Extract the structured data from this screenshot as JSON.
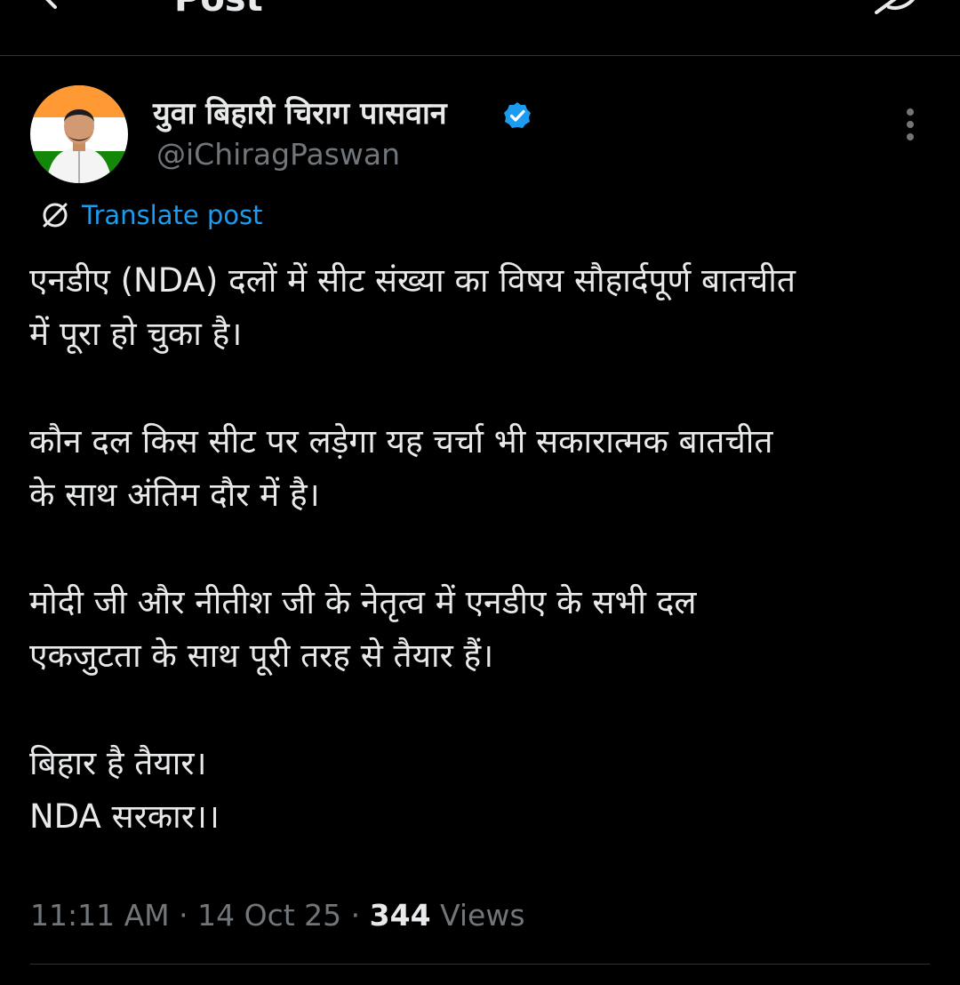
{
  "header": {
    "title": "Post"
  },
  "post": {
    "author": {
      "display_name": "युवा बिहारी चिराग पासवान",
      "handle": "@iChiragPaswan",
      "verified": true
    },
    "translate_label": "Translate post",
    "paragraphs": [
      [
        "एनडीए (NDA) दलों में सीट संख्या का विषय सौहार्दपूर्ण बातचीत",
        "में पूरा हो चुका है।"
      ],
      [
        "कौन दल किस सीट पर लड़ेगा यह चर्चा भी सकारात्मक बातचीत",
        "के साथ अंतिम दौर में है।"
      ],
      [
        "मोदी जी और नीतीश जी के नेतृत्व में एनडीए के सभी दल",
        "एकजुटता के साथ पूरी तरह से तैयार हैं।"
      ],
      [
        "बिहार है तैयार।",
        "NDA सरकार।।"
      ]
    ],
    "time": "11:11 AM",
    "separator": " · ",
    "date": "14 Oct 25",
    "views_count": "344",
    "views_label": " Views"
  },
  "colors": {
    "background": "#000000",
    "text": "#e7e9ea",
    "muted": "#71767b",
    "link": "#1d9bf0",
    "divider": "#2f3336"
  },
  "icons": {
    "back": "back-arrow-icon",
    "grok": "grok-icon",
    "verified": "verified-badge-icon",
    "more": "more-vertical-icon",
    "translate": "globe-slash-icon"
  }
}
